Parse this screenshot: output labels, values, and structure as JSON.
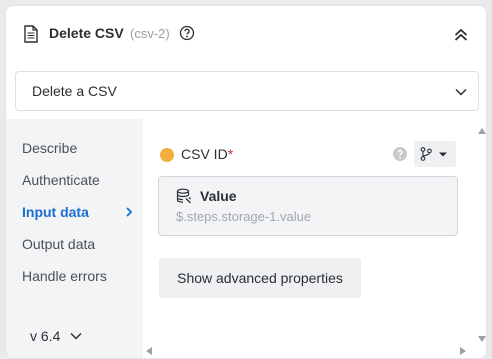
{
  "header": {
    "title": "Delete CSV",
    "subtitle": "(csv-2)",
    "doc_icon": "document-icon",
    "help_icon": "help-icon",
    "collapse_icon": "chevron-up-double-icon"
  },
  "action_select": {
    "value": "Delete a CSV"
  },
  "sidebar": {
    "items": [
      {
        "label": "Describe",
        "active": false
      },
      {
        "label": "Authenticate",
        "active": false
      },
      {
        "label": "Input data",
        "active": true
      },
      {
        "label": "Output data",
        "active": false
      },
      {
        "label": "Handle errors",
        "active": false
      }
    ],
    "version": "v 6.4"
  },
  "field": {
    "label": "CSV ID",
    "required_mark": "*",
    "status_color": "#f4ae3d",
    "value_title": "Value",
    "value_text": "$.steps.storage-1.value"
  },
  "advanced_button": "Show advanced properties",
  "colors": {
    "accent": "#1a6fd0",
    "required": "#d22a2a"
  }
}
